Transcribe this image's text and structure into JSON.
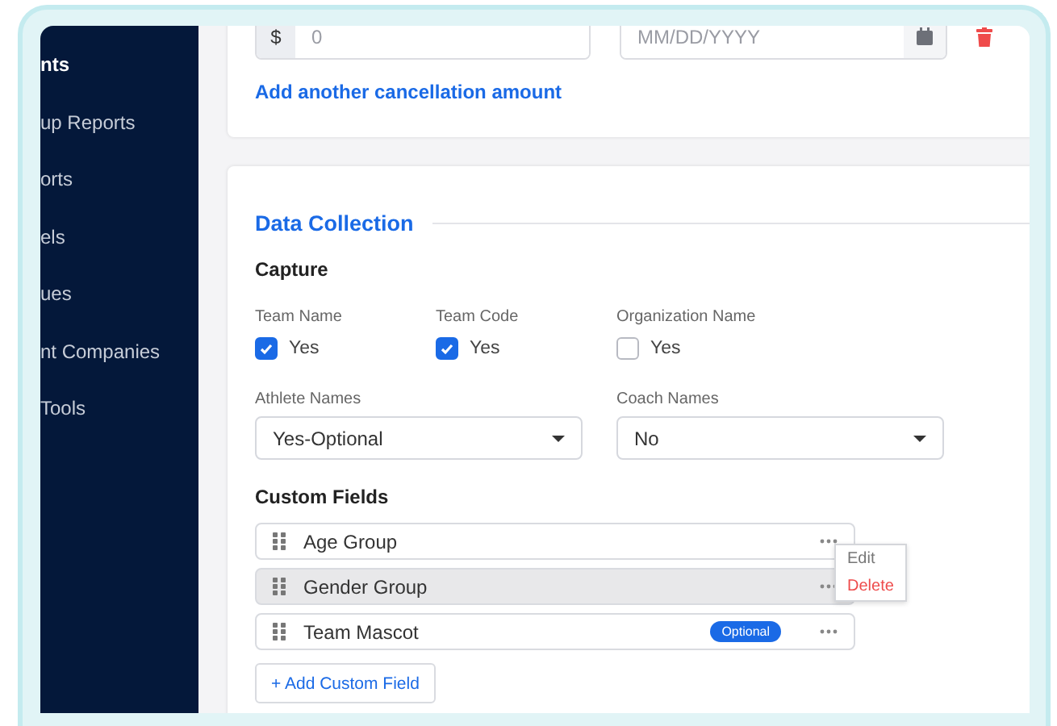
{
  "sidebar": {
    "items": [
      {
        "label": "nts",
        "selected": true
      },
      {
        "label": "up Reports",
        "selected": false
      },
      {
        "label": "orts",
        "selected": false
      },
      {
        "label": "els",
        "selected": false
      },
      {
        "label": "ues",
        "selected": false
      },
      {
        "label": "nt Companies",
        "selected": false
      },
      {
        "label": "Tools",
        "selected": false
      }
    ]
  },
  "cancellation": {
    "currency": "$",
    "amount_placeholder": "0",
    "date_placeholder": "MM/DD/YYYY",
    "add_link": "Add another cancellation amount"
  },
  "data_collection": {
    "title": "Data Collection",
    "capture": {
      "heading": "Capture",
      "options": [
        {
          "label": "Team Name",
          "option": "Yes",
          "checked": true
        },
        {
          "label": "Team Code",
          "option": "Yes",
          "checked": true
        },
        {
          "label": "Organization Name",
          "option": "Yes",
          "checked": false
        }
      ]
    },
    "selects": [
      {
        "label": "Athlete Names",
        "value": "Yes-Optional"
      },
      {
        "label": "Coach Names",
        "value": "No"
      }
    ],
    "custom_fields": {
      "heading": "Custom Fields",
      "items": [
        {
          "name": "Age Group",
          "selected": false,
          "menu": [
            {
              "label": "Edit",
              "kind": "normal"
            },
            {
              "label": "Delete",
              "kind": "danger"
            }
          ]
        },
        {
          "name": "Gender Group",
          "selected": true
        },
        {
          "name": "Team Mascot",
          "selected": false,
          "badge": "Optional"
        }
      ],
      "add_button": "+ Add Custom Field"
    }
  }
}
